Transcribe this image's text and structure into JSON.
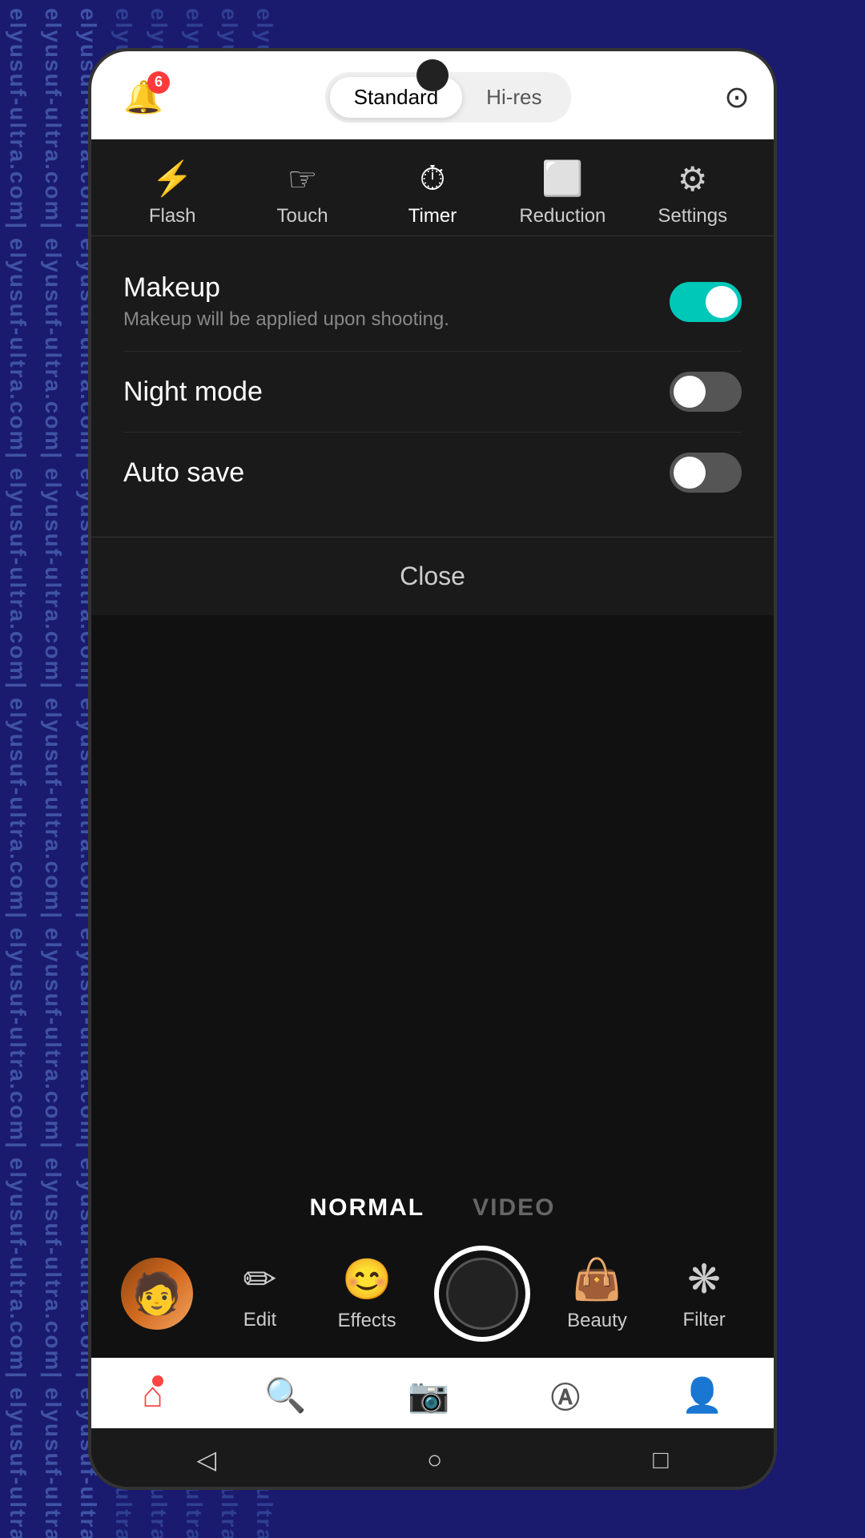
{
  "watermark": {
    "text": "elyusuf-ultra.com| elyusuf-ultra.",
    "color": "rgba(100,140,220,0.55)"
  },
  "topBar": {
    "badge": "6",
    "modes": [
      "Standard",
      "Hi-res"
    ],
    "activeMode": "Standard"
  },
  "toolbar": {
    "items": [
      {
        "id": "flash",
        "label": "Flash",
        "icon": "⚡"
      },
      {
        "id": "touch",
        "label": "Touch",
        "icon": "👆"
      },
      {
        "id": "timer",
        "label": "Timer",
        "icon": "⏱"
      },
      {
        "id": "reduction",
        "label": "Reduction",
        "icon": "⬜"
      },
      {
        "id": "settings",
        "label": "Settings",
        "icon": "⚙"
      }
    ],
    "active": "settings"
  },
  "settings": {
    "makeup": {
      "label": "Makeup",
      "sublabel": "Makeup will be applied upon shooting.",
      "enabled": true
    },
    "nightMode": {
      "label": "Night mode",
      "enabled": false
    },
    "autoSave": {
      "label": "Auto save",
      "enabled": false
    },
    "closeLabel": "Close"
  },
  "camera": {
    "modeTabs": [
      "NORMAL",
      "VIDEO"
    ],
    "activeMode": "NORMAL"
  },
  "bottomTools": [
    {
      "id": "edit",
      "label": "Edit",
      "icon": "✏"
    },
    {
      "id": "effects",
      "label": "Effects",
      "icon": "😊"
    },
    {
      "id": "shutter",
      "label": "",
      "icon": ""
    },
    {
      "id": "beauty",
      "label": "Beauty",
      "icon": "👜"
    },
    {
      "id": "filter",
      "label": "Filter",
      "icon": "❋"
    }
  ],
  "navBar": {
    "items": [
      {
        "id": "home",
        "icon": "⌂",
        "hasNotif": true
      },
      {
        "id": "search",
        "icon": "🔍",
        "hasNotif": false
      },
      {
        "id": "camera",
        "icon": "📷",
        "hasNotif": false,
        "active": true
      },
      {
        "id": "ai",
        "icon": "🅐",
        "hasNotif": false
      },
      {
        "id": "profile",
        "icon": "👤",
        "hasNotif": false
      }
    ]
  },
  "systemNav": {
    "back": "◁",
    "home": "○",
    "recent": "□"
  }
}
